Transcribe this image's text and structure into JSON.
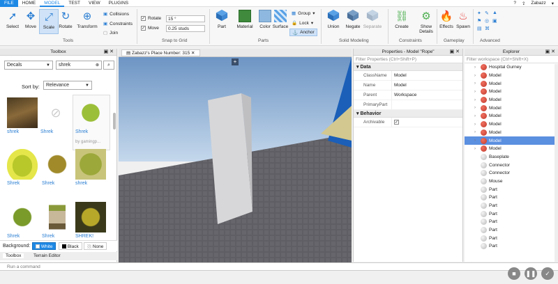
{
  "menu": {
    "tabs": [
      "FILE",
      "HOME",
      "MODEL",
      "TEST",
      "VIEW",
      "PLUGINS"
    ],
    "user": "Zabazz"
  },
  "ribbon": {
    "tools": {
      "select": "Select",
      "move": "Move",
      "scale": "Scale",
      "rotate": "Rotate",
      "transform": "Transform",
      "group_label": "Tools"
    },
    "options": {
      "collisions": "Collisions",
      "constraints": "Constraints",
      "join": "Join"
    },
    "snap": {
      "rotate_label": "Rotate",
      "rotate_value": "15 °",
      "move_label": "Move",
      "move_value": "0.25 studs",
      "group_label": "Snap to Grid"
    },
    "parts": {
      "part": "Part",
      "material": "Material",
      "color": "Color",
      "surface": "Surface",
      "group": "Group",
      "lock": "Lock",
      "anchor": "Anchor",
      "group_label": "Parts"
    },
    "solid": {
      "union": "Union",
      "negate": "Negate",
      "separate": "Separate",
      "group_label": "Solid Modeling"
    },
    "constraints": {
      "create": "Create",
      "show_details": "Show Details",
      "group_label": "Constraints"
    },
    "gameplay": {
      "effects": "Effects",
      "spawn": "Spawn",
      "group_label": "Gameplay"
    },
    "advanced": {
      "group_label": "Advanced"
    }
  },
  "toolbox": {
    "title": "Toolbox",
    "category": "Decals",
    "search_value": "shrek",
    "sort_label": "Sort by:",
    "sort_value": "Relevance",
    "items": [
      {
        "label": "shrek"
      },
      {
        "label": "Shrek"
      },
      {
        "label": "Shrek"
      },
      {
        "label": "Shrek"
      },
      {
        "label": "Shrek"
      },
      {
        "label": "shrek"
      },
      {
        "label": "Shrek"
      },
      {
        "label": "Shrek"
      },
      {
        "label": "SHREK!"
      }
    ],
    "hover_caption": "by gamingp...",
    "background_label": "Background:",
    "bg_white": "White",
    "bg_black": "Black",
    "bg_none": "None",
    "tab_toolbox": "Toolbox",
    "tab_terrain": "Terrain Editor"
  },
  "viewport": {
    "tab_title": "Zabazz's Place Number: 315"
  },
  "properties": {
    "title": "Properties - Model \"Rope\"",
    "filter_placeholder": "Filter Properties (Ctrl+Shift+P)",
    "data_section": "Data",
    "rows": [
      {
        "key": "ClassName",
        "value": "Model"
      },
      {
        "key": "Name",
        "value": "Model"
      },
      {
        "key": "Parent",
        "value": "Workspace"
      },
      {
        "key": "PrimaryPart",
        "value": ""
      }
    ],
    "behavior_section": "Behavior",
    "archivable": "Archivable"
  },
  "explorer": {
    "title": "Explorer",
    "filter_placeholder": "Filter workspace (Ctrl+Shift+X)",
    "items": [
      {
        "label": "Hospital Gurney",
        "kind": "model"
      },
      {
        "label": "Model",
        "kind": "model"
      },
      {
        "label": "Model",
        "kind": "model"
      },
      {
        "label": "Model",
        "kind": "model"
      },
      {
        "label": "Model",
        "kind": "model"
      },
      {
        "label": "Model",
        "kind": "model"
      },
      {
        "label": "Model",
        "kind": "model"
      },
      {
        "label": "Model",
        "kind": "model"
      },
      {
        "label": "Model",
        "kind": "model"
      },
      {
        "label": "Model",
        "kind": "model",
        "selected": true
      },
      {
        "label": "Model",
        "kind": "model"
      },
      {
        "label": "Baseplate",
        "kind": "part"
      },
      {
        "label": "Connector",
        "kind": "part"
      },
      {
        "label": "Connector",
        "kind": "part"
      },
      {
        "label": "Mouse",
        "kind": "part"
      },
      {
        "label": "Part",
        "kind": "part"
      },
      {
        "label": "Part",
        "kind": "part"
      },
      {
        "label": "Part",
        "kind": "part"
      },
      {
        "label": "Part",
        "kind": "part"
      },
      {
        "label": "Part",
        "kind": "part"
      },
      {
        "label": "Part",
        "kind": "part"
      },
      {
        "label": "Part",
        "kind": "part"
      },
      {
        "label": "Part",
        "kind": "part"
      }
    ]
  },
  "command_bar": {
    "placeholder": "Run a command"
  },
  "colors": {
    "accent": "#1e88e5",
    "selection": "#5b8fe0"
  }
}
